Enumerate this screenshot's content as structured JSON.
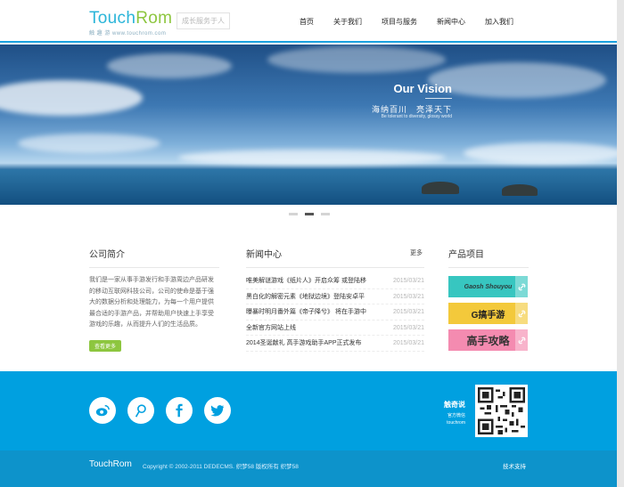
{
  "header": {
    "logo": {
      "text_a": "Touch",
      "text_b": "Rom",
      "sub": "触 趣 游  www.touchrom.com"
    },
    "slogan": "成长服务于人",
    "nav": [
      {
        "label": "首页"
      },
      {
        "label": "关于我们"
      },
      {
        "label": "项目与服务"
      },
      {
        "label": "新闻中心"
      },
      {
        "label": "加入我们"
      }
    ]
  },
  "banner": {
    "title": "Our Vision",
    "subtitle_cn": "海纳百川　亮泽天下",
    "subtitle_en": "Be tolerant to diversity, glossy world"
  },
  "intro": {
    "heading": "公司简介",
    "text": "我们是一家从事手游发行和手游周边产品研发的移动互联网科技公司，公司的使命是基于强大的数据分析和处理能力，为每一个用户提供最合适的手游产品，并帮助用户快速上手享受游戏的乐趣，从而提升人们的生活品质。",
    "more": "查看更多"
  },
  "news": {
    "heading": "新闻中心",
    "more": "更多",
    "items": [
      {
        "title": "唯美解谜游戏《纸片人》开启众筹 或登陆移",
        "date": "2015/03/21"
      },
      {
        "title": "黑白化的解密元素《地狱边境》登陆安卓平",
        "date": "2015/03/21"
      },
      {
        "title": "曝暴时明月番外篇《帝子降兮》 将在手游中",
        "date": "2015/03/21"
      },
      {
        "title": "全新官方网站上线",
        "date": "2015/03/21"
      },
      {
        "title": "2014圣诞献礼 高手游戏助手APP正式发布",
        "date": "2015/03/21"
      }
    ]
  },
  "products": {
    "heading": "产品项目",
    "items": [
      {
        "label": "Gaosh Shouyou",
        "color": "#37c6c0"
      },
      {
        "label": "G搞手游",
        "color": "#f3c93b"
      },
      {
        "label": "高手攻略",
        "color": "#f48bb0"
      }
    ]
  },
  "footer": {
    "social": [
      "weibo-icon",
      "tencent-weibo-icon",
      "facebook-icon",
      "twitter-icon"
    ],
    "qr_title": "触奇说",
    "qr_line2": "官方微信",
    "qr_line3": "touchrom",
    "logo": "TouchRom",
    "copyright": "Copyright © 2002-2011 DEDECMS. 织梦58 版权所有  织梦58",
    "tech": "技术支持"
  },
  "colors": {
    "brand_blue": "#00a0e0",
    "brand_green": "#8dc63f"
  }
}
